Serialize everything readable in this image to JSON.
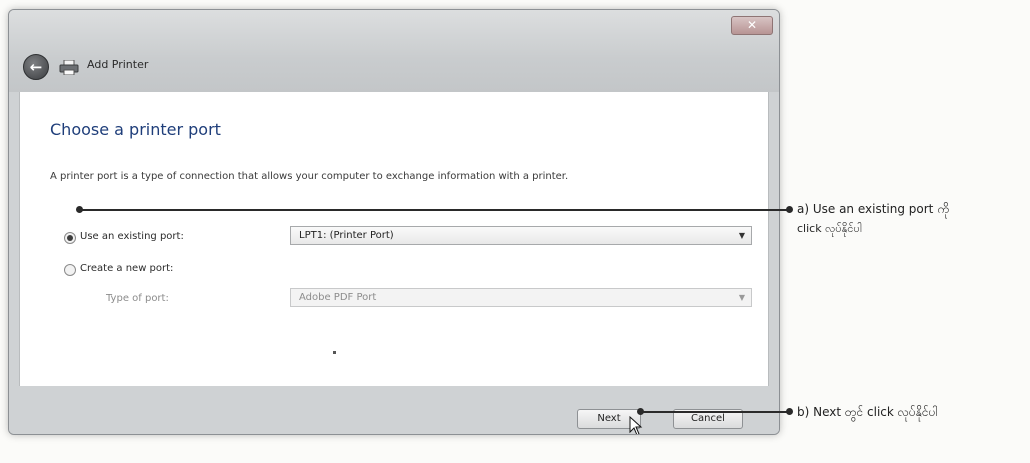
{
  "window": {
    "title": "Add Printer",
    "close_glyph": "✕",
    "back_glyph": "←"
  },
  "page": {
    "heading": "Choose a printer port",
    "description": "A printer port is a type of connection that allows your computer to exchange information with a printer."
  },
  "options": {
    "existing_port": {
      "label": "Use an existing port:",
      "selected": true,
      "value": "LPT1: (Printer Port)"
    },
    "new_port": {
      "label": "Create a new port:",
      "selected": false
    },
    "type_of_port": {
      "label": "Type of port:",
      "value": "Adobe PDF Port",
      "enabled": false
    }
  },
  "buttons": {
    "next": "Next",
    "cancel": "Cancel"
  },
  "annotations": {
    "a_line1": "a) Use an existing port ကို",
    "a_line2": "click လုပ်နိုင်ပါ",
    "b": "b) Next တွင် click လုပ်နိုင်ပါ"
  },
  "icons": {
    "back": "back-arrow-icon",
    "printer": "printer-icon",
    "close": "close-icon",
    "dropdown": "chevron-down-icon",
    "cursor": "mouse-pointer-icon"
  },
  "colors": {
    "heading": "#1f3e7a",
    "close_button": "#b79494",
    "annotation": "#2a2a2a"
  }
}
